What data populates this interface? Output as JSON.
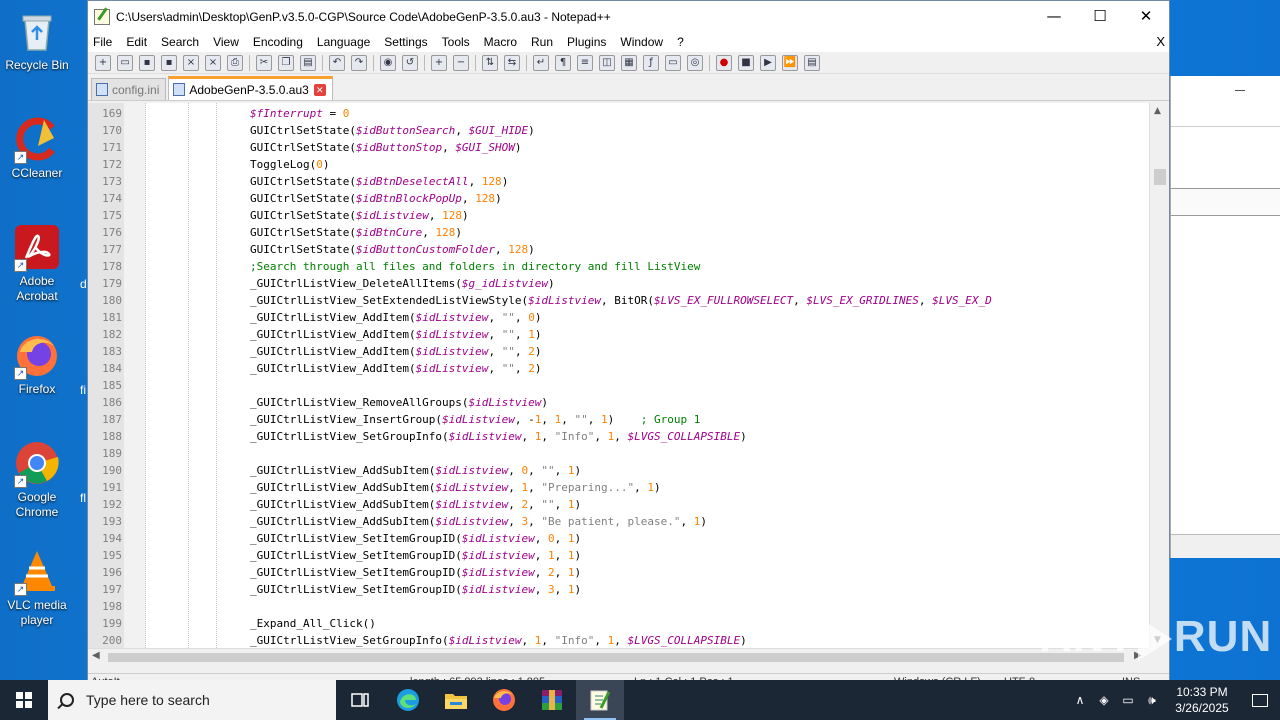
{
  "desktop": {
    "icons": [
      {
        "label": "Recycle Bin",
        "icon": "recycle-bin-icon"
      },
      {
        "label": "CCleaner",
        "icon": "ccleaner-icon"
      },
      {
        "label": "Adobe Acrobat",
        "icon": "acrobat-icon"
      },
      {
        "label": "Firefox",
        "icon": "firefox-icon"
      },
      {
        "label": "Google Chrome",
        "icon": "chrome-icon"
      },
      {
        "label": "VLC media player",
        "icon": "vlc-icon"
      }
    ],
    "peek_labels": [
      "d",
      "fi",
      "fl"
    ]
  },
  "window": {
    "title": "C:\\Users\\admin\\Desktop\\GenP.v3.5.0-CGP\\Source Code\\AdobeGenP-3.5.0.au3 - Notepad++",
    "minimize": "—",
    "maximize": "☐",
    "close": "✕"
  },
  "menu": [
    "File",
    "Edit",
    "Search",
    "View",
    "Encoding",
    "Language",
    "Settings",
    "Tools",
    "Macro",
    "Run",
    "Plugins",
    "Window",
    "?"
  ],
  "menu_close": "X",
  "tabs": [
    {
      "label": "config.ini",
      "active": false
    },
    {
      "label": "AdobeGenP-3.5.0.au3",
      "active": true
    }
  ],
  "tab_close": "✕",
  "code": [
    {
      "no": "169",
      "html": "<span class=\"v\">$fInterrupt</span> = <span class=\"n\">0</span>"
    },
    {
      "no": "170",
      "html": "GUICtrlSetState(<span class=\"v\">$idButtonSearch</span>, <span class=\"v\">$GUI_HIDE</span>)"
    },
    {
      "no": "171",
      "html": "GUICtrlSetState(<span class=\"v\">$idButtonStop</span>, <span class=\"v\">$GUI_SHOW</span>)"
    },
    {
      "no": "172",
      "html": "ToggleLog(<span class=\"n\">0</span>)"
    },
    {
      "no": "173",
      "html": "GUICtrlSetState(<span class=\"v\">$idBtnDeselectAll</span>, <span class=\"n\">128</span>)"
    },
    {
      "no": "174",
      "html": "GUICtrlSetState(<span class=\"v\">$idBtnBlockPopUp</span>, <span class=\"n\">128</span>)"
    },
    {
      "no": "175",
      "html": "GUICtrlSetState(<span class=\"v\">$idListview</span>, <span class=\"n\">128</span>)"
    },
    {
      "no": "176",
      "html": "GUICtrlSetState(<span class=\"v\">$idBtnCure</span>, <span class=\"n\">128</span>)"
    },
    {
      "no": "177",
      "html": "GUICtrlSetState(<span class=\"v\">$idButtonCustomFolder</span>, <span class=\"n\">128</span>)"
    },
    {
      "no": "178",
      "html": "<span class=\"c\">;Search through all files and folders in directory and fill ListView</span>"
    },
    {
      "no": "179",
      "html": "_GUICtrlListView_DeleteAllItems(<span class=\"v\">$g_idListview</span>)"
    },
    {
      "no": "180",
      "html": "_GUICtrlListView_SetExtendedListViewStyle(<span class=\"v\">$idListview</span>, BitOR(<span class=\"v\">$LVS_EX_FULLROWSELECT</span>, <span class=\"v\">$LVS_EX_GRIDLINES</span>, <span class=\"v\">$LVS_EX_D</span>"
    },
    {
      "no": "181",
      "html": "_GUICtrlListView_AddItem(<span class=\"v\">$idListview</span>, <span class=\"s\">\"\"</span>, <span class=\"n\">0</span>)"
    },
    {
      "no": "182",
      "html": "_GUICtrlListView_AddItem(<span class=\"v\">$idListview</span>, <span class=\"s\">\"\"</span>, <span class=\"n\">1</span>)"
    },
    {
      "no": "183",
      "html": "_GUICtrlListView_AddItem(<span class=\"v\">$idListview</span>, <span class=\"s\">\"\"</span>, <span class=\"n\">2</span>)"
    },
    {
      "no": "184",
      "html": "_GUICtrlListView_AddItem(<span class=\"v\">$idListview</span>, <span class=\"s\">\"\"</span>, <span class=\"n\">2</span>)"
    },
    {
      "no": "185",
      "html": ""
    },
    {
      "no": "186",
      "html": "_GUICtrlListView_RemoveAllGroups(<span class=\"v\">$idListview</span>)"
    },
    {
      "no": "187",
      "html": "_GUICtrlListView_InsertGroup(<span class=\"v\">$idListview</span>, -<span class=\"n\">1</span>, <span class=\"n\">1</span>, <span class=\"s\">\"\"</span>, <span class=\"n\">1</span>)    <span class=\"c\">; Group 1</span>"
    },
    {
      "no": "188",
      "html": "_GUICtrlListView_SetGroupInfo(<span class=\"v\">$idListview</span>, <span class=\"n\">1</span>, <span class=\"s\">\"Info\"</span>, <span class=\"n\">1</span>, <span class=\"v\">$LVGS_COLLAPSIBLE</span>)"
    },
    {
      "no": "189",
      "html": ""
    },
    {
      "no": "190",
      "html": "_GUICtrlListView_AddSubItem(<span class=\"v\">$idListview</span>, <span class=\"n\">0</span>, <span class=\"s\">\"\"</span>, <span class=\"n\">1</span>)"
    },
    {
      "no": "191",
      "html": "_GUICtrlListView_AddSubItem(<span class=\"v\">$idListview</span>, <span class=\"n\">1</span>, <span class=\"s\">\"Preparing...\"</span>, <span class=\"n\">1</span>)"
    },
    {
      "no": "192",
      "html": "_GUICtrlListView_AddSubItem(<span class=\"v\">$idListview</span>, <span class=\"n\">2</span>, <span class=\"s\">\"\"</span>, <span class=\"n\">1</span>)"
    },
    {
      "no": "193",
      "html": "_GUICtrlListView_AddSubItem(<span class=\"v\">$idListview</span>, <span class=\"n\">3</span>, <span class=\"s\">\"Be patient, please.\"</span>, <span class=\"n\">1</span>)"
    },
    {
      "no": "194",
      "html": "_GUICtrlListView_SetItemGroupID(<span class=\"v\">$idListview</span>, <span class=\"n\">0</span>, <span class=\"n\">1</span>)"
    },
    {
      "no": "195",
      "html": "_GUICtrlListView_SetItemGroupID(<span class=\"v\">$idListview</span>, <span class=\"n\">1</span>, <span class=\"n\">1</span>)"
    },
    {
      "no": "196",
      "html": "_GUICtrlListView_SetItemGroupID(<span class=\"v\">$idListview</span>, <span class=\"n\">2</span>, <span class=\"n\">1</span>)"
    },
    {
      "no": "197",
      "html": "_GUICtrlListView_SetItemGroupID(<span class=\"v\">$idListview</span>, <span class=\"n\">3</span>, <span class=\"n\">1</span>)"
    },
    {
      "no": "198",
      "html": ""
    },
    {
      "no": "199",
      "html": "_Expand_All_Click()"
    },
    {
      "no": "200",
      "html": "_GUICtrlListView_SetGroupInfo(<span class=\"v\">$idListview</span>, <span class=\"n\">1</span>, <span class=\"s\">\"Info\"</span>, <span class=\"n\">1</span>, <span class=\"v\">$LVGS_COLLAPSIBLE</span>)"
    }
  ],
  "status": {
    "lang": "AutoIt",
    "length": "length : 65,893    lines : 1,805",
    "pos": "Ln : 1    Col : 1    Pos : 1",
    "eol": "Windows (CR LF)",
    "enc": "UTF-8",
    "mode": "INS"
  },
  "taskbar": {
    "search_placeholder": "Type here to search",
    "time": "10:33 PM",
    "date": "3/26/2025"
  },
  "watermark": {
    "left": "ANY",
    "right": "RUN"
  },
  "colors": {
    "variable": "#a0008a",
    "number": "#ff8000",
    "comment": "#008000",
    "string": "#808080",
    "tab_accent": "#f9a12e"
  }
}
